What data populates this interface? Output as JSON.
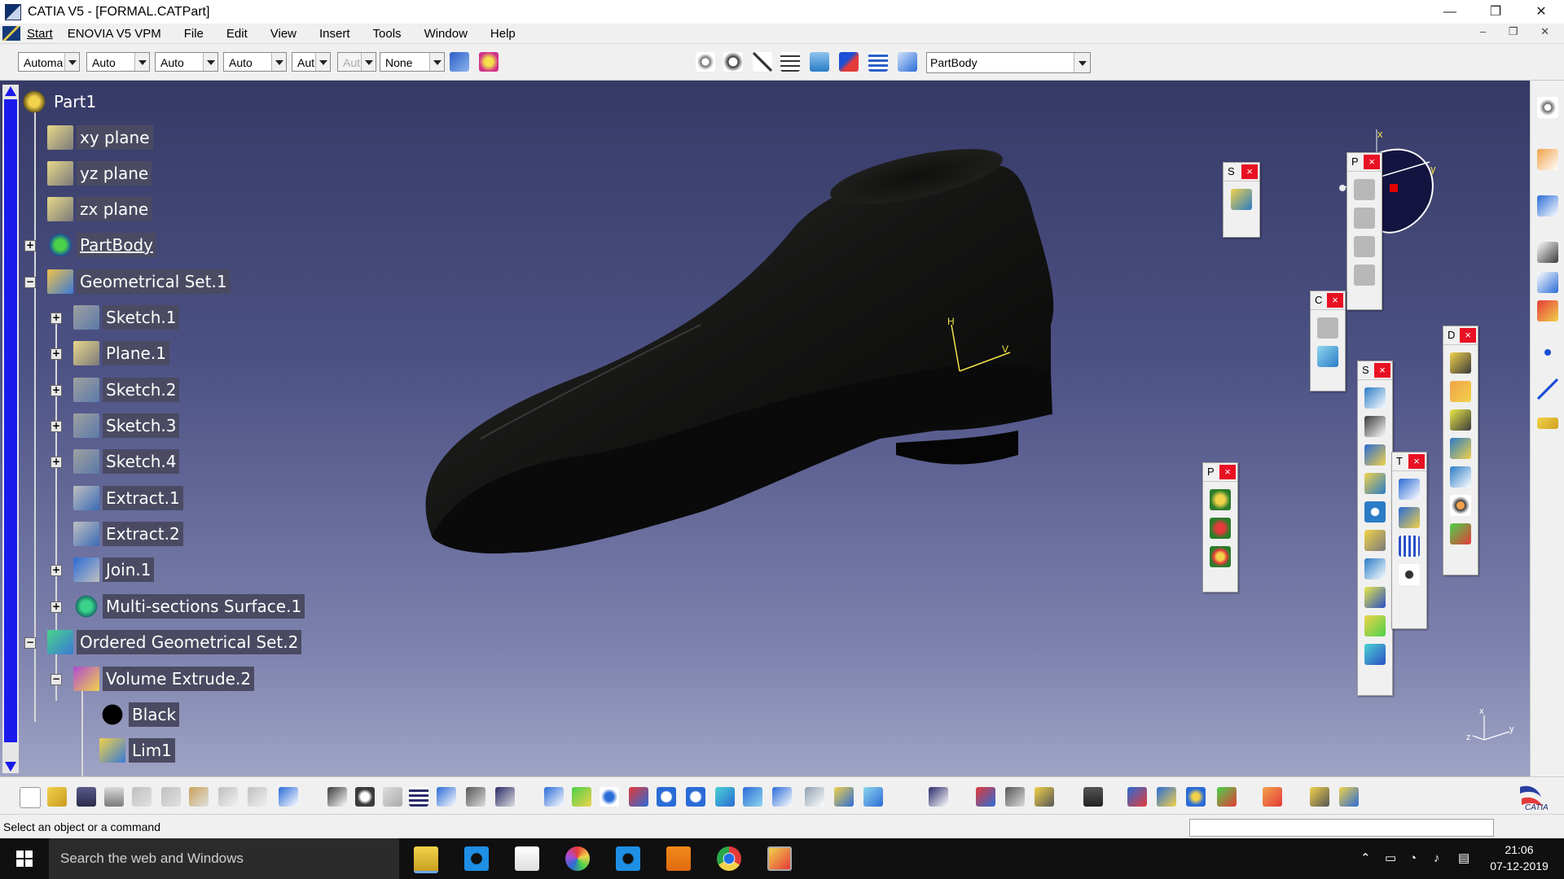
{
  "window": {
    "title": "CATIA V5 - [FORMAL.CATPart]",
    "controls": [
      "—",
      "❐",
      "✕"
    ]
  },
  "menu": {
    "items": [
      "Start",
      "ENOVIA V5 VPM",
      "File",
      "Edit",
      "View",
      "Insert",
      "Tools",
      "Window",
      "Help"
    ],
    "mdi": "– ❐ ✕"
  },
  "toolbar": {
    "combos": [
      "Automa",
      "Auto",
      "Auto",
      "Auto",
      "Aut",
      "Aut",
      "None"
    ],
    "current_body": "PartBody"
  },
  "tree": {
    "root": "Part1",
    "nodes": [
      {
        "label": "xy plane"
      },
      {
        "label": "yz plane"
      },
      {
        "label": "zx plane"
      },
      {
        "label": "PartBody"
      },
      {
        "label": "Geometrical Set.1"
      },
      {
        "label": "Sketch.1"
      },
      {
        "label": "Plane.1"
      },
      {
        "label": "Sketch.2"
      },
      {
        "label": "Sketch.3"
      },
      {
        "label": "Sketch.4"
      },
      {
        "label": "Extract.1"
      },
      {
        "label": "Extract.2"
      },
      {
        "label": "Join.1"
      },
      {
        "label": "Multi-sections Surface.1"
      },
      {
        "label": "Ordered Geometrical Set.2"
      },
      {
        "label": "Volume Extrude.2"
      },
      {
        "label": "Black"
      },
      {
        "label": "Lim1"
      }
    ]
  },
  "panels": {
    "p1": "S",
    "p2": "P",
    "p3": "C",
    "p4": "S",
    "p5": "T",
    "p6": "D",
    "p7": "P",
    "close": "×"
  },
  "axes": {
    "x": "x",
    "y": "y",
    "z": "z",
    "sketch_h": "H",
    "sketch_v": "V"
  },
  "statusbar": {
    "prompt": "Select an object or a command"
  },
  "taskbar": {
    "search_placeholder": "Search the web and Windows",
    "time": "21:06",
    "date": "07-12-2019"
  },
  "colors": {
    "viewport_top": "#363a66",
    "viewport_bottom": "#9fa3c4",
    "tree_highlight": "#4a4a62",
    "scrollbar": "#1a1aee"
  }
}
